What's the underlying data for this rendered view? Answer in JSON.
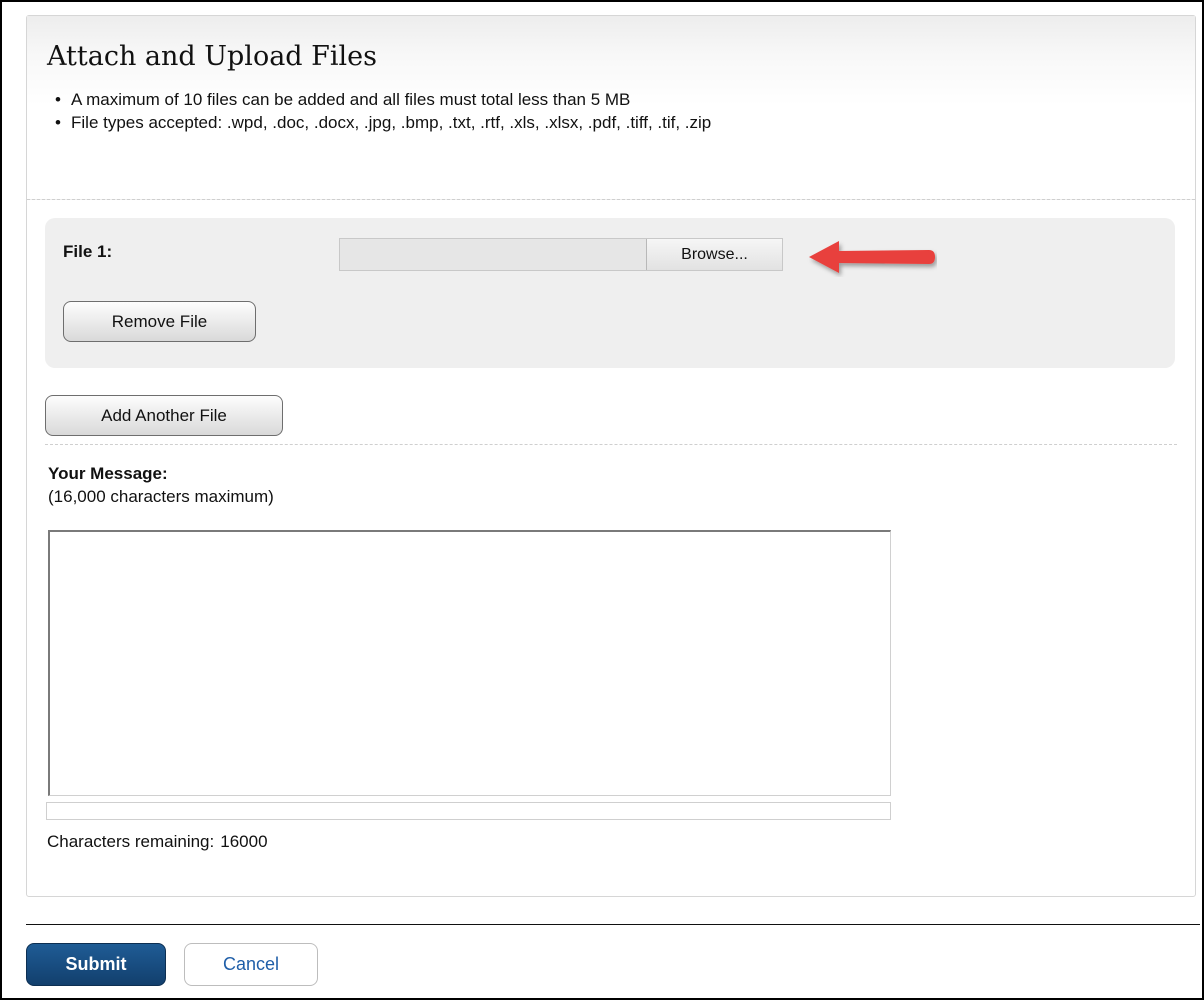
{
  "header": {
    "title": "Attach and Upload Files",
    "bullets": [
      "A maximum of 10 files can be added and all files must total less than 5 MB",
      "File types accepted: .wpd, .doc, .docx, .jpg, .bmp, .txt, .rtf, .xls, .xlsx, .pdf, .tiff, .tif, .zip"
    ]
  },
  "files": [
    {
      "label": "File 1:",
      "path_value": "",
      "browse_label": "Browse...",
      "remove_label": "Remove File"
    }
  ],
  "add_file_label": "Add Another File",
  "message": {
    "label": "Your Message:",
    "hint": "(16,000 characters maximum)",
    "value": "",
    "chars_remaining_label": "Characters remaining:",
    "chars_remaining_value": "16000"
  },
  "actions": {
    "submit_label": "Submit",
    "cancel_label": "Cancel"
  },
  "annotation": {
    "icon": "red-arrow-left-icon",
    "color": "#e8413c"
  },
  "colors": {
    "submit_bg": "#1a4f82",
    "cancel_text": "#1f5ea8",
    "file_box_bg": "#efefef"
  }
}
